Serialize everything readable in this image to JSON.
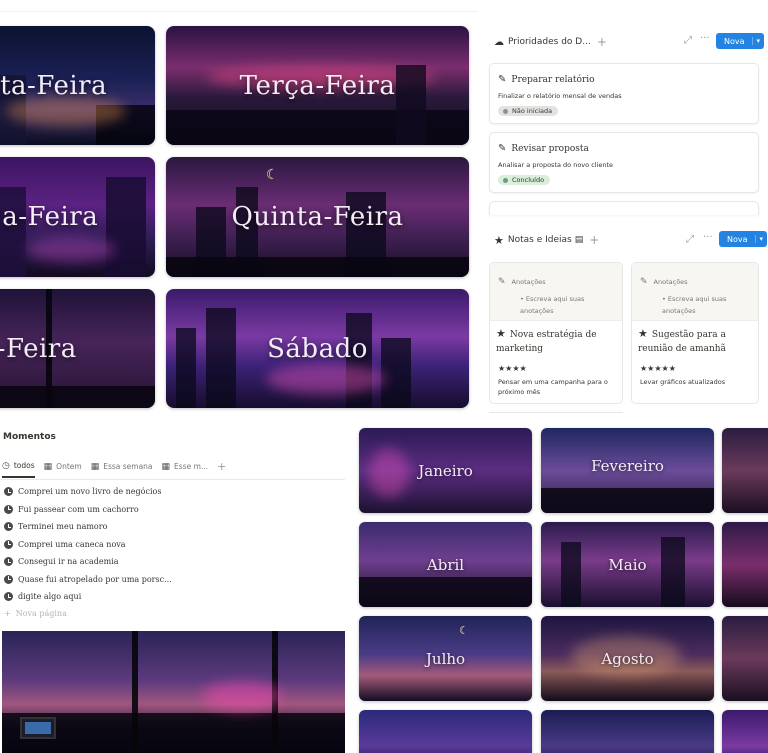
{
  "weekdays": [
    {
      "label": "ta-Feira"
    },
    {
      "label": "Terça-Feira"
    },
    {
      "label": "a-Feira"
    },
    {
      "label": "Quinta-Feira"
    },
    {
      "label": "-Feira"
    },
    {
      "label": "Sábado"
    }
  ],
  "priorities": {
    "title": "Prioridades do D...",
    "new_label": "Nova",
    "tasks": [
      {
        "title": "Preparar relatório",
        "desc": "Finalizar o relatório mensal de vendas",
        "status": "Não iniciada"
      },
      {
        "title": "Revisar proposta",
        "desc": "Analisar a proposta do novo cliente",
        "status": "Concluído"
      }
    ],
    "status_colors": {
      "not_started": "#e3e2e0",
      "done": "#dbeddb"
    }
  },
  "notes": {
    "title": "Notas e Ideias",
    "new_label": "Nova",
    "cards": [
      {
        "preview_label": "Anotações",
        "preview_bullet": "Escreva aqui suas anotações",
        "title": "Nova estratégia de marketing",
        "stars": "★★★★",
        "desc": "Pensar em uma campanha para o próximo mês"
      },
      {
        "preview_label": "Anotações",
        "preview_bullet": "Escreva aqui suas anotações",
        "title": "Sugestão para a reunião de amanhã",
        "stars": "★★★★★",
        "desc": "Levar gráficos atualizados"
      }
    ]
  },
  "moments": {
    "title": "Momentos",
    "tabs": [
      "todos",
      "Ontem",
      "Essa semana",
      "Esse m..."
    ],
    "items": [
      "Comprei um novo livro de negócios",
      "Fui passear com um cachorro",
      "Terminei meu namoro",
      "Comprei uma caneca nova",
      "Consegui ir na academia",
      "Quase fui atropelado por uma porsc...",
      "digite algo aqui"
    ],
    "new_page": "Nova página"
  },
  "months": [
    {
      "label": "Janeiro"
    },
    {
      "label": "Fevereiro"
    },
    {
      "label": "Abril"
    },
    {
      "label": "Maio"
    },
    {
      "label": "Julho"
    },
    {
      "label": "Agosto"
    }
  ],
  "colors": {
    "accent": "#2383e2",
    "text": "#37352f",
    "muted": "#787774"
  }
}
